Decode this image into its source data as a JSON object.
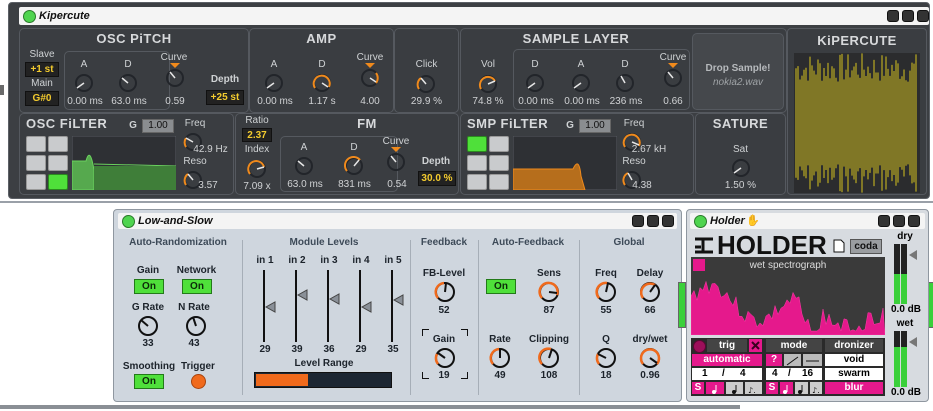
{
  "kipercute": {
    "title": "Kipercute",
    "brand": "KiPERCUTE",
    "osc_pitch": {
      "heading": "OSC PiTCH",
      "slave_label": "Slave",
      "slave_value": "+1 st",
      "main_label": "Main",
      "main_value": "G#0",
      "a_label": "A",
      "a_value": "0.00 ms",
      "d_label": "D",
      "d_value": "63.0 ms",
      "curve_label": "Curve",
      "curve_value": "0.59",
      "depth_label": "Depth",
      "depth_value": "+25 st"
    },
    "amp": {
      "heading": "AMP",
      "a_label": "A",
      "a_value": "0.00 ms",
      "d_label": "D",
      "d_value": "1.17 s",
      "curve_label": "Curve",
      "curve_value": "4.00"
    },
    "click": {
      "label": "Click",
      "value": "29.9 %"
    },
    "sample_layer": {
      "heading": "SAMPLE LAYER",
      "vol_label": "Vol",
      "vol_value": "74.8 %",
      "d1_label": "D",
      "d1_value": "0.00 ms",
      "a_label": "A",
      "a_value": "0.00 ms",
      "d2_label": "D",
      "d2_value": "236 ms",
      "curve_label": "Curve",
      "curve_value": "0.66",
      "drop_text": "Drop Sample!",
      "file_name": "nokia2.wav"
    },
    "osc_filter": {
      "heading": "OSC FiLTER",
      "g_label": "G",
      "g_value": "1.00",
      "freq_label": "Freq",
      "freq_value": "42.9 Hz",
      "reso_label": "Reso",
      "reso_value": "3.57"
    },
    "fm": {
      "heading": "FM",
      "ratio_label": "Ratio",
      "ratio_value": "2.37",
      "index_label": "Index",
      "index_value": "7.09 x",
      "a_label": "A",
      "a_value": "63.0 ms",
      "d_label": "D",
      "d_value": "831 ms",
      "curve_label": "Curve",
      "curve_value": "0.54",
      "depth_label": "Depth",
      "depth_value": "30.0 %"
    },
    "smp_filter": {
      "heading": "SMP FiLTER",
      "g_label": "G",
      "g_value": "1.00",
      "freq_label": "Freq",
      "freq_value": "2.67 kH",
      "reso_label": "Reso",
      "reso_value": "4.38"
    },
    "sature": {
      "heading": "SATURE",
      "sat_label": "Sat",
      "sat_value": "1.50 %"
    },
    "colors": {
      "accent": "#f08a1c",
      "bg": "#3c3f43",
      "yellow": "#f3cb2e",
      "green": "#4fe03a"
    }
  },
  "low_and_slow": {
    "title": "Low-and-Slow",
    "auto_rand": {
      "heading": "Auto-Randomization",
      "gain_label": "Gain",
      "gain_btn": "On",
      "network_label": "Network",
      "network_btn": "On",
      "grate_label": "G Rate",
      "grate_value": "33",
      "nrate_label": "N Rate",
      "nrate_value": "43",
      "smoothing_label": "Smoothing",
      "smoothing_btn": "On",
      "trigger_label": "Trigger"
    },
    "module_levels": {
      "heading": "Module Levels",
      "channels": [
        {
          "label": "in 1",
          "value": "29"
        },
        {
          "label": "in 2",
          "value": "39"
        },
        {
          "label": "in 3",
          "value": "36"
        },
        {
          "label": "in 4",
          "value": "29"
        },
        {
          "label": "in 5",
          "value": "35"
        }
      ],
      "range_label": "Level Range"
    },
    "feedback": {
      "heading": "Feedback",
      "fblevel_label": "FB-Level",
      "fblevel_value": "52",
      "gain_label": "Gain",
      "gain_value": "19"
    },
    "auto_feedback": {
      "heading": "Auto-Feedback",
      "on_btn": "On",
      "sens_label": "Sens",
      "sens_value": "87",
      "rate_label": "Rate",
      "rate_value": "49",
      "clip_label": "Clipping",
      "clip_value": "108"
    },
    "global": {
      "heading": "Global",
      "freq_label": "Freq",
      "freq_value": "55",
      "delay_label": "Delay",
      "delay_value": "66",
      "q_label": "Q",
      "q_value": "18",
      "drywet_label": "dry/wet",
      "drywet_value": "0.96"
    }
  },
  "holder": {
    "title": "Holder",
    "logo": "HOLDER",
    "coda_btn": "coda",
    "dry_label": "dry",
    "dry_value": "0.0 dB",
    "wet_label": "wet",
    "wet_value": "0.0 dB",
    "graph_label": "wet spectrograph",
    "trig_label": "trig",
    "mode_label": "mode",
    "dronizer_label": "dronizer",
    "automatic_btn": "automatic",
    "q_btn": "?",
    "trig_num": "1",
    "trig_slash": "/",
    "trig_den": "4",
    "mode_num": "4",
    "mode_slash": "/",
    "mode_den": "16",
    "s_btn": "S",
    "void_btn": "void",
    "swarm_btn": "swarm",
    "blur_btn": "blur",
    "colors": {
      "pink": "#e5198c",
      "graph_bg": "#3a3a3a"
    }
  }
}
